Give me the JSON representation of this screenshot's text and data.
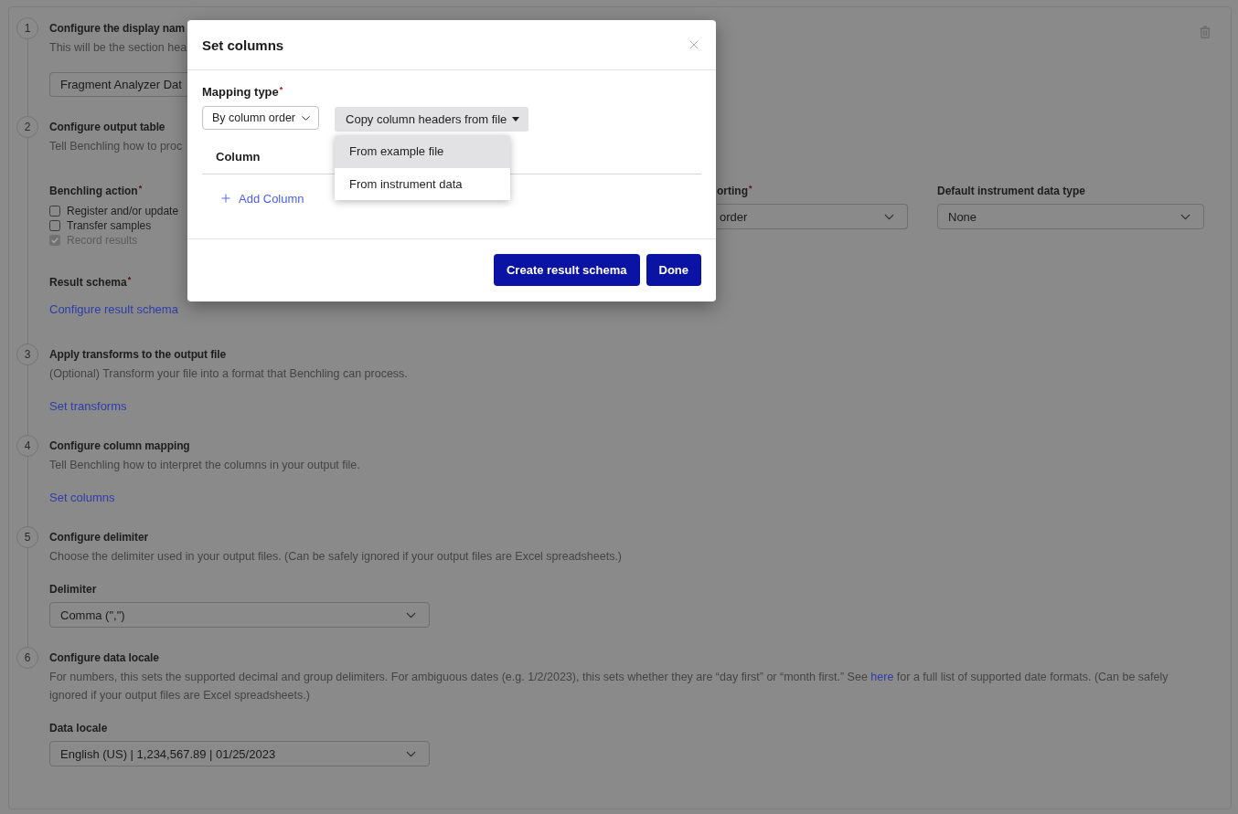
{
  "modal": {
    "title": "Set columns",
    "mapping_type": {
      "label": "Mapping type",
      "required_mark": "*",
      "value": "By column order"
    },
    "copy_button": {
      "label": "Copy column headers from file",
      "expanded": true
    },
    "menu": [
      {
        "label": "From example file",
        "selected": true
      },
      {
        "label": "From instrument data",
        "selected": false
      }
    ],
    "table": {
      "columns": [
        "Column"
      ]
    },
    "add_button": "Add Column",
    "buttons": [
      {
        "label": "Create result schema"
      },
      {
        "label": "Done"
      }
    ]
  },
  "steps": [
    {
      "number": "1",
      "title": "Configure the display nam",
      "description": [
        {
          "kind": "text",
          "text": "This will be the section hea"
        }
      ],
      "fields": [
        {
          "kind": "input",
          "value": "Fragment Analyzer Dat",
          "clipped": true
        }
      ]
    },
    {
      "number": "2",
      "title": "Configure output table",
      "description": [
        {
          "kind": "text",
          "text": "Tell Benchling how to proc"
        }
      ],
      "fields": [
        {
          "kind": "row",
          "items": [
            {
              "kind": "checkboxes",
              "label": "Benchling action",
              "required_mark": "*",
              "options": [
                {
                  "label": "Register and/or update",
                  "checked": false,
                  "disabled": false
                },
                {
                  "label": "Transfer samples",
                  "checked": false,
                  "disabled": false
                },
                {
                  "label": "Record results",
                  "checked": true,
                  "disabled": true
                }
              ]
            },
            {
              "kind": "select",
              "label": "orting",
              "required_mark": "*",
              "value": "order",
              "clipped": true
            },
            {
              "kind": "select",
              "label": "Default instrument data type",
              "value": "None"
            }
          ]
        },
        {
          "kind": "link",
          "label": "Result schema",
          "required_mark": "*",
          "link": "Configure result schema"
        }
      ]
    },
    {
      "number": "3",
      "title": "Apply transforms to the output file",
      "description": [
        {
          "kind": "text",
          "text": "(Optional) Transform your file into a format that Benchling can process."
        }
      ],
      "fields": [
        {
          "kind": "link",
          "link": "Set transforms"
        }
      ]
    },
    {
      "number": "4",
      "title": "Configure column mapping",
      "description": [
        {
          "kind": "text",
          "text": "Tell Benchling how to interpret the columns in your output file."
        }
      ],
      "fields": [
        {
          "kind": "link",
          "link": "Set columns"
        }
      ]
    },
    {
      "number": "5",
      "title": "Configure delimiter",
      "description": [
        {
          "kind": "text",
          "text": "Choose the delimiter used in your output files. (Can be safely ignored if your output files are Excel spreadsheets.)"
        }
      ],
      "fields": [
        {
          "kind": "select",
          "label": "Delimiter",
          "value": "Comma (\",\")"
        }
      ]
    },
    {
      "number": "6",
      "title": "Configure data locale",
      "description": [
        {
          "kind": "text",
          "text": "For numbers, this sets the supported decimal and group delimiters. For ambiguous dates (e.g. 1/2/2023), this sets whether they are “day first” or “month first.” See "
        },
        {
          "kind": "link",
          "text": "here"
        },
        {
          "kind": "text",
          "text": " for a full list of supported date formats. (Can be safely ignored if your output files are Excel spreadsheets.)"
        }
      ],
      "fields": [
        {
          "kind": "select",
          "label": "Data locale",
          "value": "English (US) | 1,234,567.89 | 01/25/2023"
        }
      ]
    }
  ]
}
